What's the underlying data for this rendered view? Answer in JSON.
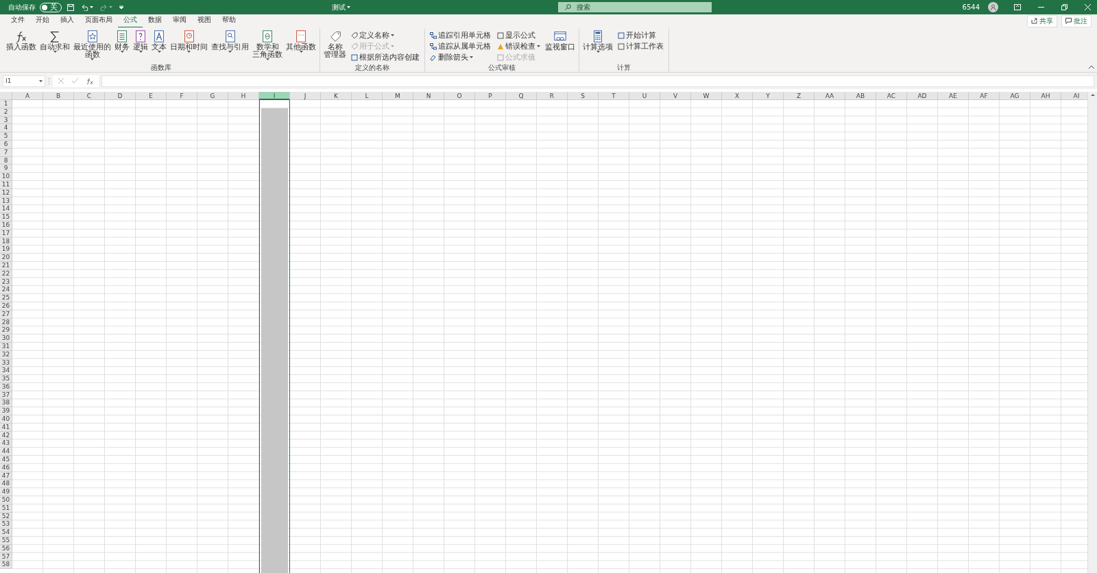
{
  "title_bar": {
    "autosave_label": "自动保存",
    "autosave": {
      "on": false,
      "label": "关"
    },
    "title": "测试",
    "search": {
      "placeholder": "搜索"
    },
    "user": "6544"
  },
  "tabs": [
    {
      "label": "文件",
      "selected": false
    },
    {
      "label": "开始",
      "selected": false
    },
    {
      "label": "插入",
      "selected": false
    },
    {
      "label": "页面布局",
      "selected": false
    },
    {
      "label": "公式",
      "selected": true
    },
    {
      "label": "数据",
      "selected": false
    },
    {
      "label": "审阅",
      "selected": false
    },
    {
      "label": "视图",
      "selected": false
    },
    {
      "label": "帮助",
      "selected": false
    }
  ],
  "share_button": "共享",
  "comments_button": "批注",
  "ribbon_groups": [
    {
      "label": "函数库",
      "items": [
        {
          "kind": "large",
          "lines": [
            "插入函数"
          ],
          "dropdown": false
        },
        {
          "kind": "large",
          "lines": [
            "自动求和"
          ],
          "dropdown": true
        },
        {
          "kind": "large",
          "lines": [
            "最近使用的",
            "函数"
          ],
          "dropdown": true
        },
        {
          "kind": "large",
          "lines": [
            "财务"
          ],
          "dropdown": true
        },
        {
          "kind": "large",
          "lines": [
            "逻辑"
          ],
          "dropdown": true
        },
        {
          "kind": "large",
          "lines": [
            "文本"
          ],
          "dropdown": true
        },
        {
          "kind": "large",
          "lines": [
            "日期和时间"
          ],
          "dropdown": true
        },
        {
          "kind": "large",
          "lines": [
            "查找与引用"
          ],
          "dropdown": true
        },
        {
          "kind": "large",
          "lines": [
            "数学和",
            "三角函数"
          ],
          "dropdown": true
        },
        {
          "kind": "large",
          "lines": [
            "其他函数"
          ],
          "dropdown": true
        }
      ]
    },
    {
      "label": "定义的名称",
      "items": [
        {
          "kind": "large",
          "lines": [
            "名称",
            "管理器"
          ],
          "dropdown": false
        },
        {
          "kind": "stack",
          "buttons": [
            {
              "label": "定义名称",
              "dropdown": true,
              "disabled": false
            },
            {
              "label": "用于公式",
              "dropdown": true,
              "disabled": true
            },
            {
              "label": "根据所选内容创建",
              "dropdown": false,
              "disabled": false
            }
          ]
        }
      ]
    },
    {
      "label": "公式审核",
      "items": [
        {
          "kind": "stack",
          "buttons": [
            {
              "label": "追踪引用单元格",
              "dropdown": false,
              "disabled": false
            },
            {
              "label": "追踪从属单元格",
              "dropdown": false,
              "disabled": false
            },
            {
              "label": "删除箭头",
              "dropdown": true,
              "disabled": false
            }
          ]
        },
        {
          "kind": "stack",
          "buttons": [
            {
              "label": "显示公式",
              "dropdown": false,
              "disabled": false
            },
            {
              "label": "错误检查",
              "dropdown": true,
              "disabled": false
            },
            {
              "label": "公式求值",
              "dropdown": false,
              "disabled": true
            }
          ]
        },
        {
          "kind": "large",
          "lines": [
            "监视窗口"
          ],
          "dropdown": false
        }
      ]
    },
    {
      "label": "计算",
      "items": [
        {
          "kind": "large",
          "lines": [
            "计算选项"
          ],
          "dropdown": true
        },
        {
          "kind": "stack",
          "buttons": [
            {
              "label": "开始计算",
              "dropdown": false,
              "disabled": false
            },
            {
              "label": "计算工作表",
              "dropdown": false,
              "disabled": false
            }
          ]
        }
      ]
    }
  ],
  "formula_bar": {
    "name_box": "I1"
  },
  "sheet": {
    "columns": [
      {
        "label": "A",
        "selected": false
      },
      {
        "label": "B",
        "selected": false
      },
      {
        "label": "C",
        "selected": false
      },
      {
        "label": "D",
        "selected": false
      },
      {
        "label": "E",
        "selected": false
      },
      {
        "label": "F",
        "selected": false
      },
      {
        "label": "G",
        "selected": false
      },
      {
        "label": "H",
        "selected": false
      },
      {
        "label": "I",
        "selected": true
      },
      {
        "label": "J",
        "selected": false
      },
      {
        "label": "K",
        "selected": false
      },
      {
        "label": "L",
        "selected": false
      },
      {
        "label": "M",
        "selected": false
      },
      {
        "label": "N",
        "selected": false
      },
      {
        "label": "O",
        "selected": false
      },
      {
        "label": "P",
        "selected": false
      },
      {
        "label": "Q",
        "selected": false
      },
      {
        "label": "R",
        "selected": false
      },
      {
        "label": "S",
        "selected": false
      },
      {
        "label": "T",
        "selected": false
      },
      {
        "label": "U",
        "selected": false
      },
      {
        "label": "V",
        "selected": false
      },
      {
        "label": "W",
        "selected": false
      },
      {
        "label": "X",
        "selected": false
      },
      {
        "label": "Y",
        "selected": false
      },
      {
        "label": "Z",
        "selected": false
      },
      {
        "label": "AA",
        "selected": false
      },
      {
        "label": "AB",
        "selected": false
      },
      {
        "label": "AC",
        "selected": false
      },
      {
        "label": "AD",
        "selected": false
      },
      {
        "label": "AE",
        "selected": false
      },
      {
        "label": "AF",
        "selected": false
      },
      {
        "label": "AG",
        "selected": false
      },
      {
        "label": "AH",
        "selected": false
      },
      {
        "label": "AI",
        "selected": false
      }
    ],
    "rows": [
      "1",
      "2",
      "3",
      "4",
      "5",
      "6",
      "7",
      "8",
      "9",
      "10",
      "11",
      "12",
      "13",
      "14",
      "15",
      "16",
      "17",
      "18",
      "19",
      "20",
      "21",
      "22",
      "23",
      "24",
      "25",
      "26",
      "27",
      "28",
      "29",
      "30",
      "31",
      "32",
      "33",
      "34",
      "35",
      "36",
      "37",
      "38",
      "39",
      "40",
      "41",
      "42",
      "43",
      "44",
      "45",
      "46",
      "47",
      "48",
      "49",
      "50",
      "51",
      "52",
      "53",
      "54",
      "55",
      "56",
      "57",
      "58"
    ]
  }
}
